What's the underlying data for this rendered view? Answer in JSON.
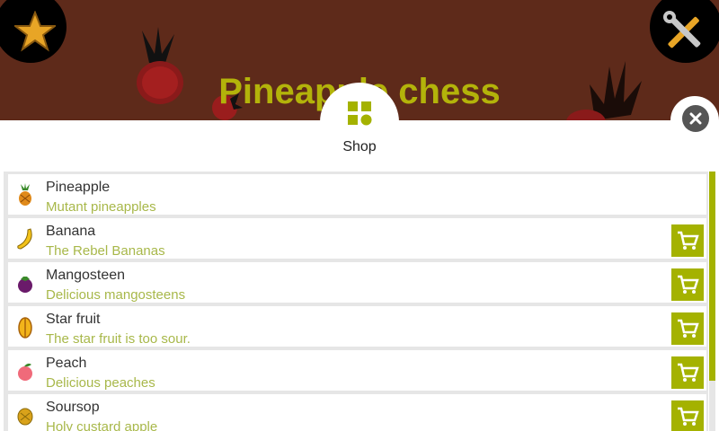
{
  "header": {
    "title": "Pineapple chess",
    "favorite_icon": "star-icon",
    "settings_icon": "tools-icon"
  },
  "shop": {
    "tab_label": "Shop",
    "tab_icon": "grid-icon",
    "close_icon": "close-icon"
  },
  "items": [
    {
      "name": "Pineapple",
      "description": "Mutant pineapples",
      "icon": "pineapple-icon",
      "buy_icon": ""
    },
    {
      "name": "Banana",
      "description": "The Rebel Bananas",
      "icon": "banana-icon",
      "buy_icon": "cart-icon"
    },
    {
      "name": "Mangosteen",
      "description": "Delicious mangosteens",
      "icon": "mangosteen-icon",
      "buy_icon": "cart-icon"
    },
    {
      "name": "Star fruit",
      "description": "The star fruit is too sour.",
      "icon": "starfruit-icon",
      "buy_icon": "cart-icon"
    },
    {
      "name": "Peach",
      "description": "Delicious peaches",
      "icon": "peach-icon",
      "buy_icon": "cart-icon"
    },
    {
      "name": "Soursop",
      "description": "Holy custard apple",
      "icon": "soursop-icon",
      "buy_icon": "cart-icon"
    }
  ],
  "colors": {
    "banner": "#5e2a1a",
    "title": "#b3b30a",
    "accent": "#a4b200",
    "description": "#a8b84a"
  }
}
